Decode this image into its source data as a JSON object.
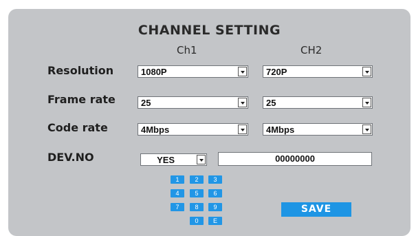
{
  "title": "CHANNEL SETTING",
  "columns": {
    "ch1": "Ch1",
    "ch2": "CH2"
  },
  "rows": {
    "resolution": {
      "label": "Resolution",
      "ch1": "1080P",
      "ch2": "720P"
    },
    "frame_rate": {
      "label": "Frame rate",
      "ch1": "25",
      "ch2": "25"
    },
    "code_rate": {
      "label": "Code rate",
      "ch1": "4Mbps",
      "ch2": "4Mbps"
    }
  },
  "dev_no": {
    "label": "DEV.NO",
    "enabled": "YES",
    "value": "00000000"
  },
  "keypad": [
    "1",
    "2",
    "3",
    "4",
    "5",
    "6",
    "7",
    "8",
    "9",
    "0",
    "E"
  ],
  "save_label": "SAVE",
  "colors": {
    "panel": "#c3c5c8",
    "accent": "#1e95e4"
  }
}
